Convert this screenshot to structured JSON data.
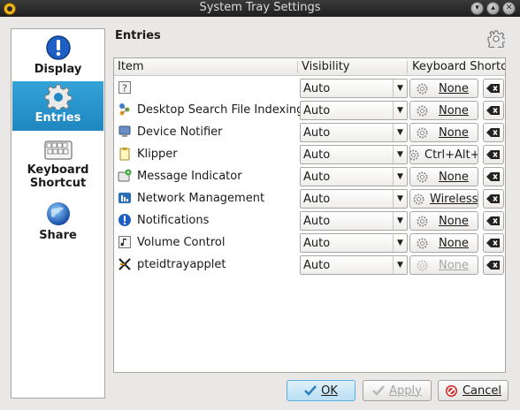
{
  "window": {
    "title": "System Tray Settings"
  },
  "sidebar": {
    "items": [
      {
        "label": "Display",
        "icon": "info-icon"
      },
      {
        "label": "Entries",
        "icon": "gear-icon"
      },
      {
        "label": "Keyboard Shortcut",
        "icon": "keyboard-icon"
      },
      {
        "label": "Share",
        "icon": "globe-icon"
      }
    ],
    "active_index": 1
  },
  "panel": {
    "title": "Entries"
  },
  "table": {
    "columns": [
      "Item",
      "Visibility",
      "Keyboard Shortc"
    ],
    "rows": [
      {
        "name": "",
        "icon": "unknown-icon",
        "visibility": "Auto",
        "shortcut": "None",
        "shortcut_enabled": true
      },
      {
        "name": "Desktop Search File Indexing",
        "icon": "nepomuk-icon",
        "visibility": "Auto",
        "shortcut": "None",
        "shortcut_enabled": true
      },
      {
        "name": "Device Notifier",
        "icon": "device-icon",
        "visibility": "Auto",
        "shortcut": "None",
        "shortcut_enabled": true
      },
      {
        "name": "Klipper",
        "icon": "clipboard-icon",
        "visibility": "Auto",
        "shortcut": "Ctrl+Alt+V",
        "shortcut_enabled": true
      },
      {
        "name": "Message Indicator",
        "icon": "message-icon",
        "visibility": "Auto",
        "shortcut": "None",
        "shortcut_enabled": true
      },
      {
        "name": "Network Management",
        "icon": "network-icon",
        "visibility": "Auto",
        "shortcut": "Wireless",
        "shortcut_enabled": true
      },
      {
        "name": "Notifications",
        "icon": "notification-icon",
        "visibility": "Auto",
        "shortcut": "None",
        "shortcut_enabled": true
      },
      {
        "name": "Volume Control",
        "icon": "volume-icon",
        "visibility": "Auto",
        "shortcut": "None",
        "shortcut_enabled": true
      },
      {
        "name": "pteidtrayapplet",
        "icon": "pteid-icon",
        "visibility": "Auto",
        "shortcut": "None",
        "shortcut_enabled": false
      }
    ]
  },
  "buttons": {
    "ok": "OK",
    "apply": "Apply",
    "cancel": "Cancel"
  },
  "colors": {
    "accent": "#2596cf",
    "titlebar": "#2a2a2a"
  }
}
